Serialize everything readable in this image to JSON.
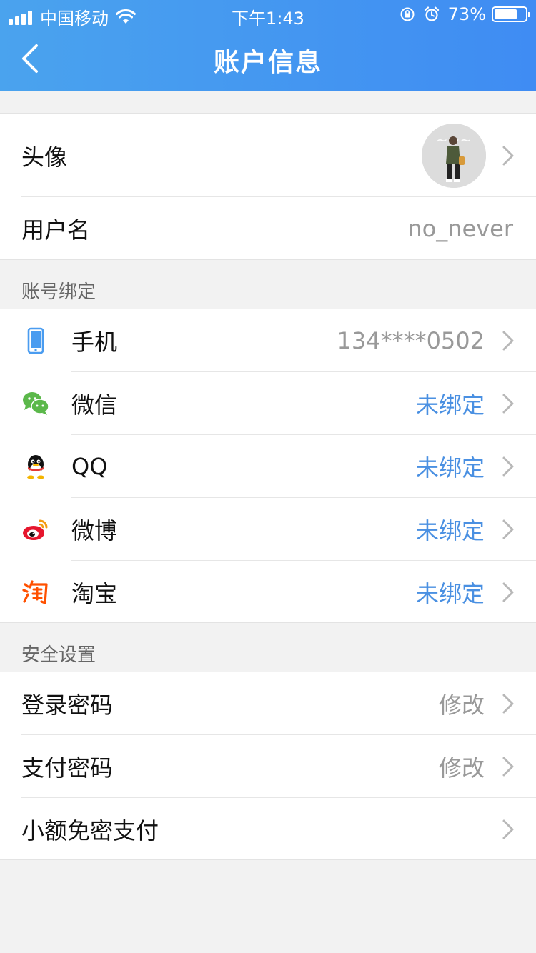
{
  "status_bar": {
    "carrier": "中国移动",
    "time": "下午1:43",
    "battery": "73%",
    "battery_level": 0.73
  },
  "nav": {
    "title": "账户信息",
    "back_icon": "back-chevron-icon"
  },
  "profile": {
    "avatar_label": "头像",
    "username_label": "用户名",
    "username_value": "no_never"
  },
  "binding": {
    "section_title": "账号绑定",
    "items": [
      {
        "icon": "phone-icon",
        "label": "手机",
        "value": "134****0502",
        "value_color": "#999999"
      },
      {
        "icon": "wechat-icon",
        "label": "微信",
        "value": "未绑定",
        "value_color": "#4a90e2"
      },
      {
        "icon": "qq-icon",
        "label": "QQ",
        "value": "未绑定",
        "value_color": "#4a90e2"
      },
      {
        "icon": "weibo-icon",
        "label": "微博",
        "value": "未绑定",
        "value_color": "#4a90e2"
      },
      {
        "icon": "taobao-icon",
        "label": "淘宝",
        "value": "未绑定",
        "value_color": "#4a90e2"
      }
    ]
  },
  "security": {
    "section_title": "安全设置",
    "items": [
      {
        "label": "登录密码",
        "value": "修改"
      },
      {
        "label": "支付密码",
        "value": "修改"
      },
      {
        "label": "小额免密支付",
        "value": ""
      }
    ]
  },
  "colors": {
    "header_start": "#4aa3ee",
    "header_end": "#3f8cf3",
    "link_blue": "#4a90e2"
  }
}
